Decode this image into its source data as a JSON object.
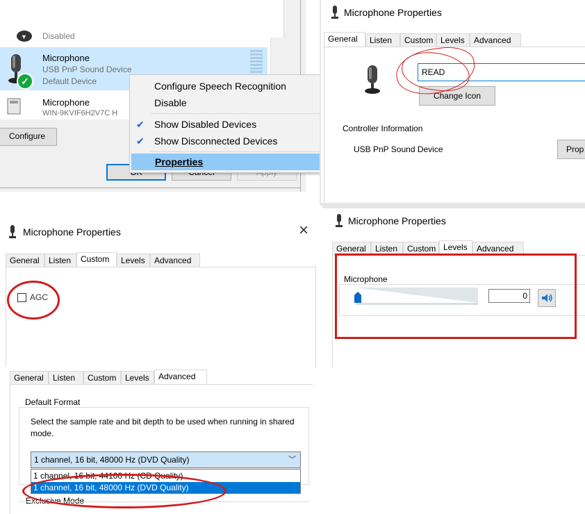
{
  "sound_list": {
    "disabled_label": "Disabled",
    "device1": {
      "name": "Microphone",
      "driver": "USB PnP Sound Device",
      "status": "Default Device"
    },
    "device2": {
      "name": "Microphone",
      "driver": "WIN-9KVIF6H2V7C H"
    },
    "configure_button": "Configure",
    "ok_button": "OK",
    "cancel_button": "Cancel",
    "apply_button": "Apply"
  },
  "context_menu": {
    "items": [
      {
        "label": "Configure Speech Recognition",
        "checked": false
      },
      {
        "label": "Disable",
        "checked": false
      },
      {
        "label": "Show Disabled Devices",
        "checked": true
      },
      {
        "label": "Show Disconnected Devices",
        "checked": true
      },
      {
        "label": "Properties",
        "checked": false,
        "highlighted": true
      }
    ]
  },
  "general_panel": {
    "title": "Microphone Properties",
    "tabs": [
      "General",
      "Listen",
      "Custom",
      "Levels",
      "Advanced"
    ],
    "device_name_value": "READ",
    "change_icon_button": "Change Icon",
    "controller_label": "Controller Information",
    "controller_value": "USB PnP Sound Device",
    "properties_button": "Prop"
  },
  "custom_panel": {
    "title": "Microphone Properties",
    "close_icon": "×",
    "tabs": [
      "General",
      "Listen",
      "Custom",
      "Levels",
      "Advanced"
    ],
    "agc_label": "AGC",
    "agc_checked": false
  },
  "levels_panel": {
    "title": "Microphone Properties",
    "tabs": [
      "General",
      "Listen",
      "Custom",
      "Levels",
      "Advanced"
    ],
    "group_label": "Microphone",
    "level_value": "0",
    "level_fraction": 0
  },
  "advanced_panel": {
    "tabs": [
      "General",
      "Listen",
      "Custom",
      "Levels",
      "Advanced"
    ],
    "group_label": "Default Format",
    "description": "Select the sample rate and bit depth to be used when running in shared mode.",
    "selected_format": "1 channel, 16 bit, 48000 Hz (DVD Quality)",
    "options": [
      "1 channel, 16 bit, 44100 Hz (CD Quality)",
      "1 channel, 16 bit, 48000 Hz (DVD Quality)"
    ],
    "exclusive_label": "Exclusive Mode"
  },
  "colors": {
    "accent": "#0078d7",
    "annotation_red": "#d11c1c",
    "selection": "#cce8ff",
    "menu_highlight": "#91c9f7"
  }
}
